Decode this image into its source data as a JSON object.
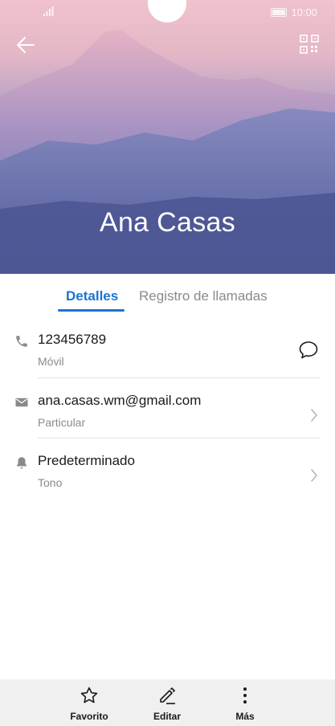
{
  "status_bar": {
    "time": "10:00"
  },
  "header": {
    "contact_name": "Ana Casas"
  },
  "tabs": [
    {
      "label": "Detalles",
      "active": true
    },
    {
      "label": "Registro de llamadas",
      "active": false
    }
  ],
  "details": [
    {
      "title": "123456789",
      "subtitle": "Móvil",
      "icon": "phone-icon",
      "action_icon": "message-icon"
    },
    {
      "title": "ana.casas.wm@gmail.com",
      "subtitle": "Particular",
      "icon": "email-icon",
      "action_icon": "chevron-right-icon"
    },
    {
      "title": "Predeterminado",
      "subtitle": "Tono",
      "icon": "bell-icon",
      "action_icon": "chevron-right-icon"
    }
  ],
  "bottom_bar": [
    {
      "label": "Favorito",
      "icon": "star-icon"
    },
    {
      "label": "Editar",
      "icon": "pencil-icon"
    },
    {
      "label": "Más",
      "icon": "more-vertical-icon"
    }
  ],
  "colors": {
    "accent": "#1a73d6",
    "header_top": "#f0c2cd",
    "header_bottom": "#4c5694"
  }
}
